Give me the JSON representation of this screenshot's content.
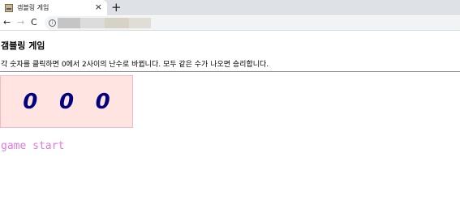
{
  "browser": {
    "tab_title": "갬블링 게임",
    "tab_close": "×",
    "new_tab": "+",
    "back": "←",
    "forward": "→",
    "reload": "C",
    "info": "i"
  },
  "page": {
    "title": "갬블링 게임",
    "description": "각 숫자를 클릭하면 0에서 2사이의 난수로 바뀝니다. 모두 같은 수가 나오면 승리합니다.",
    "digits": [
      "0",
      "0",
      "0"
    ],
    "start_label": "game start"
  },
  "colors": {
    "board_background": "#ffe4e1",
    "digit_color": "#000080",
    "start_color": "#e07ae0"
  }
}
